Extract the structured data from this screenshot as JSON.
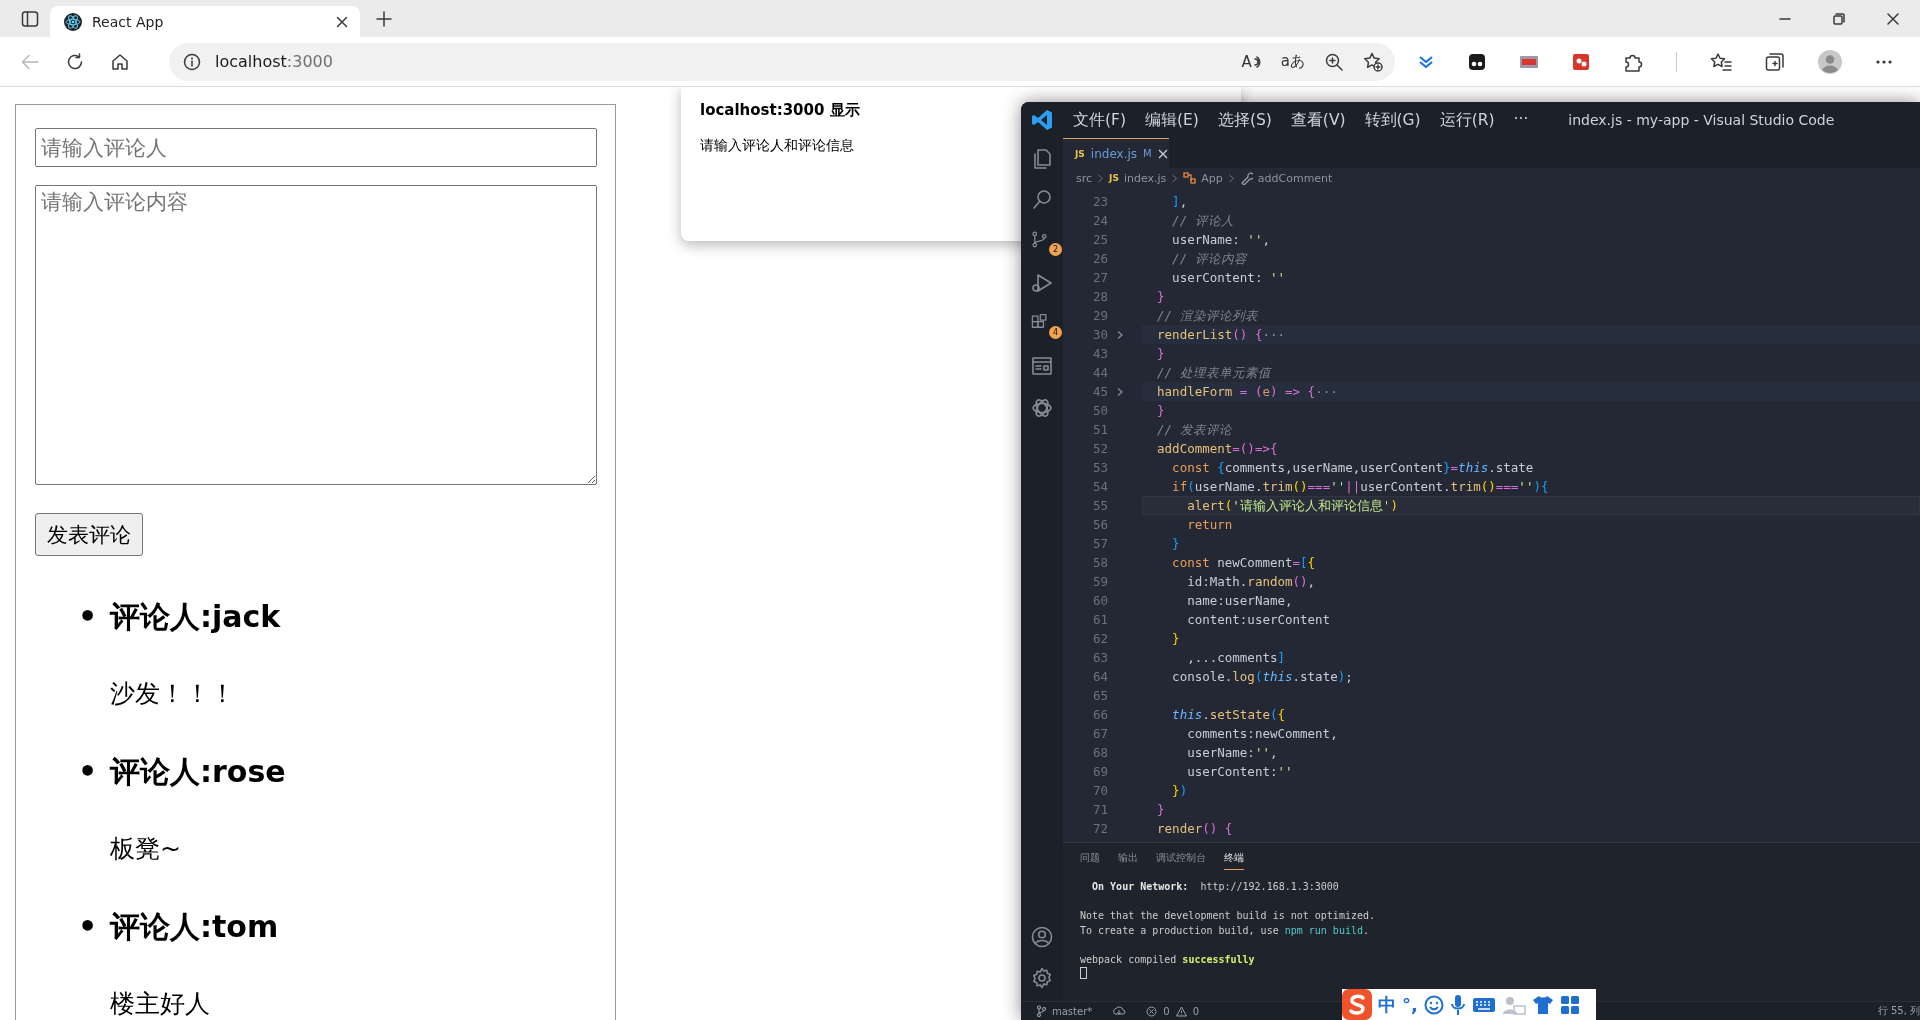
{
  "browser": {
    "tabs": [
      {
        "title": "React App",
        "selected": true
      }
    ],
    "back": {
      "disabled": true
    },
    "address": {
      "host": "localhost",
      "port": ":3000"
    },
    "read_aloud": "A",
    "translate": "aあ"
  },
  "page": {
    "name_placeholder": "请输入评论人",
    "content_placeholder": "请输入评论内容",
    "submit": "发表评论",
    "comments": [
      {
        "bullet": "•",
        "author": "评论人:jack",
        "content": "沙发！！！"
      },
      {
        "bullet": "•",
        "author": "评论人:rose",
        "content": "板凳~"
      },
      {
        "bullet": "•",
        "author": "评论人:tom",
        "content": "楼主好人"
      }
    ]
  },
  "alert": {
    "title": "localhost:3000 显示",
    "message": "请输入评论人和评论信息"
  },
  "vscode": {
    "menu": [
      "文件(F)",
      "编辑(E)",
      "选择(S)",
      "查看(V)",
      "转到(G)",
      "运行(R)",
      "···"
    ],
    "title": "index.js - my-app - Visual Studio Code",
    "scm_badge": "2",
    "extensions_badge": "4",
    "editor_tab": {
      "icon": "JS",
      "name": "index.js",
      "status": "M"
    },
    "breadcrumb": [
      {
        "kind": "folder",
        "text": "src"
      },
      {
        "kind": "file",
        "icon": "JS",
        "text": "index.js"
      },
      {
        "kind": "class",
        "text": "App"
      },
      {
        "kind": "method",
        "text": "addComment"
      }
    ],
    "lines": [
      {
        "number": "23",
        "folded": false,
        "current": false,
        "tokens": [
          {
            "text": "    ]",
            "kind": "bracket3"
          },
          {
            "text": ",",
            "kind": "plain"
          }
        ]
      },
      {
        "number": "24",
        "folded": false,
        "current": false,
        "tokens": [
          {
            "text": "    // 评论人",
            "kind": "comment"
          }
        ]
      },
      {
        "number": "25",
        "folded": false,
        "current": false,
        "tokens": [
          {
            "text": "    userName: ",
            "kind": "plain"
          },
          {
            "text": "''",
            "kind": "string"
          },
          {
            "text": ",",
            "kind": "plain"
          }
        ]
      },
      {
        "number": "26",
        "folded": false,
        "current": false,
        "tokens": [
          {
            "text": "    // 评论内容",
            "kind": "comment"
          }
        ]
      },
      {
        "number": "27",
        "folded": false,
        "current": false,
        "tokens": [
          {
            "text": "    userContent: ",
            "kind": "plain"
          },
          {
            "text": "''",
            "kind": "string"
          }
        ]
      },
      {
        "number": "28",
        "folded": false,
        "current": false,
        "tokens": [
          {
            "text": "  }",
            "kind": "bracket2"
          }
        ]
      },
      {
        "number": "29",
        "folded": false,
        "current": false,
        "tokens": [
          {
            "text": "  // 渲染评论列表",
            "kind": "comment"
          }
        ]
      },
      {
        "number": "30",
        "folded": true,
        "current": false,
        "tokens": [
          {
            "text": "  renderList",
            "kind": "function"
          },
          {
            "text": "() {",
            "kind": "bracket2"
          },
          {
            "text": "···",
            "kind": "ellipsis"
          }
        ]
      },
      {
        "number": "43",
        "folded": false,
        "current": false,
        "tokens": [
          {
            "text": "  }",
            "kind": "bracket2"
          }
        ]
      },
      {
        "number": "44",
        "folded": false,
        "current": false,
        "tokens": [
          {
            "text": "  // 处理表单元素值",
            "kind": "comment"
          }
        ]
      },
      {
        "number": "45",
        "folded": true,
        "current": false,
        "tokens": [
          {
            "text": "  handleForm",
            "kind": "function"
          },
          {
            "text": " = ",
            "kind": "operator"
          },
          {
            "text": "(",
            "kind": "bracket2"
          },
          {
            "text": "e",
            "kind": "parameter"
          },
          {
            "text": ")",
            "kind": "bracket2"
          },
          {
            "text": " => ",
            "kind": "operator"
          },
          {
            "text": "{",
            "kind": "bracket2"
          },
          {
            "text": "···",
            "kind": "ellipsis"
          }
        ]
      },
      {
        "number": "50",
        "folded": false,
        "current": false,
        "tokens": [
          {
            "text": "  }",
            "kind": "bracket2"
          }
        ]
      },
      {
        "number": "51",
        "folded": false,
        "current": false,
        "tokens": [
          {
            "text": "  // 发表评论",
            "kind": "comment"
          }
        ]
      },
      {
        "number": "52",
        "folded": false,
        "current": false,
        "tokens": [
          {
            "text": "  addComment",
            "kind": "function"
          },
          {
            "text": "=",
            "kind": "operator"
          },
          {
            "text": "()",
            "kind": "bracket2"
          },
          {
            "text": "=>",
            "kind": "operator"
          },
          {
            "text": "{",
            "kind": "bracket2"
          }
        ]
      },
      {
        "number": "53",
        "folded": false,
        "current": false,
        "tokens": [
          {
            "text": "    const ",
            "kind": "keyword"
          },
          {
            "text": "{",
            "kind": "bracket3"
          },
          {
            "text": "comments,userName,userContent",
            "kind": "plain"
          },
          {
            "text": "}",
            "kind": "bracket3"
          },
          {
            "text": "=",
            "kind": "operator"
          },
          {
            "text": "this",
            "kind": "self"
          },
          {
            "text": ".state",
            "kind": "plain"
          }
        ]
      },
      {
        "number": "54",
        "folded": false,
        "current": false,
        "tokens": [
          {
            "text": "    if",
            "kind": "keyword"
          },
          {
            "text": "(",
            "kind": "bracket3"
          },
          {
            "text": "userName.",
            "kind": "plain"
          },
          {
            "text": "trim",
            "kind": "function"
          },
          {
            "text": "()",
            "kind": "bracket1"
          },
          {
            "text": "===",
            "kind": "operator"
          },
          {
            "text": "''",
            "kind": "string"
          },
          {
            "text": "||",
            "kind": "operator"
          },
          {
            "text": "userContent.",
            "kind": "plain"
          },
          {
            "text": "trim",
            "kind": "function"
          },
          {
            "text": "()",
            "kind": "bracket1"
          },
          {
            "text": "===",
            "kind": "operator"
          },
          {
            "text": "''",
            "kind": "string"
          },
          {
            "text": "){",
            "kind": "bracket3"
          }
        ]
      },
      {
        "number": "55",
        "folded": false,
        "current": true,
        "tokens": [
          {
            "text": "      alert",
            "kind": "function"
          },
          {
            "text": "(",
            "kind": "bracket1"
          },
          {
            "text": "'请输入评论人和评论信息'",
            "kind": "string"
          },
          {
            "text": ")",
            "kind": "bracket1"
          }
        ]
      },
      {
        "number": "56",
        "folded": false,
        "current": false,
        "tokens": [
          {
            "text": "      return",
            "kind": "keyword"
          }
        ]
      },
      {
        "number": "57",
        "folded": false,
        "current": false,
        "tokens": [
          {
            "text": "    }",
            "kind": "bracket3"
          }
        ]
      },
      {
        "number": "58",
        "folded": false,
        "current": false,
        "tokens": [
          {
            "text": "    const ",
            "kind": "keyword"
          },
          {
            "text": "newComment",
            "kind": "plain"
          },
          {
            "text": "=",
            "kind": "operator"
          },
          {
            "text": "[",
            "kind": "bracket3"
          },
          {
            "text": "{",
            "kind": "bracket1"
          }
        ]
      },
      {
        "number": "59",
        "folded": false,
        "current": false,
        "tokens": [
          {
            "text": "      id:Math.",
            "kind": "plain"
          },
          {
            "text": "random",
            "kind": "function"
          },
          {
            "text": "()",
            "kind": "bracket2"
          },
          {
            "text": ",",
            "kind": "plain"
          }
        ]
      },
      {
        "number": "60",
        "folded": false,
        "current": false,
        "tokens": [
          {
            "text": "      name:userName,",
            "kind": "plain"
          }
        ]
      },
      {
        "number": "61",
        "folded": false,
        "current": false,
        "tokens": [
          {
            "text": "      content:userContent",
            "kind": "plain"
          }
        ]
      },
      {
        "number": "62",
        "folded": false,
        "current": false,
        "tokens": [
          {
            "text": "    }",
            "kind": "bracket1"
          }
        ]
      },
      {
        "number": "63",
        "folded": false,
        "current": false,
        "tokens": [
          {
            "text": "      ,...comments",
            "kind": "plain"
          },
          {
            "text": "]",
            "kind": "bracket3"
          }
        ]
      },
      {
        "number": "64",
        "folded": false,
        "current": false,
        "tokens": [
          {
            "text": "    console.",
            "kind": "plain"
          },
          {
            "text": "log",
            "kind": "function"
          },
          {
            "text": "(",
            "kind": "bracket3"
          },
          {
            "text": "this",
            "kind": "self"
          },
          {
            "text": ".state",
            "kind": "plain"
          },
          {
            "text": ")",
            "kind": "bracket3"
          },
          {
            "text": ";",
            "kind": "plain"
          }
        ]
      },
      {
        "number": "65",
        "folded": false,
        "current": false
      },
      {
        "number": "66",
        "folded": false,
        "current": false,
        "tokens": [
          {
            "text": "    this",
            "kind": "self"
          },
          {
            "text": ".",
            "kind": "plain"
          },
          {
            "text": "setState",
            "kind": "function"
          },
          {
            "text": "(",
            "kind": "bracket3"
          },
          {
            "text": "{",
            "kind": "bracket1"
          }
        ]
      },
      {
        "number": "67",
        "folded": false,
        "current": false,
        "tokens": [
          {
            "text": "      comments:newComment,",
            "kind": "plain"
          }
        ]
      },
      {
        "number": "68",
        "folded": false,
        "current": false,
        "tokens": [
          {
            "text": "      userName:",
            "kind": "plain"
          },
          {
            "text": "''",
            "kind": "string"
          },
          {
            "text": ",",
            "kind": "plain"
          }
        ]
      },
      {
        "number": "69",
        "folded": false,
        "current": false,
        "tokens": [
          {
            "text": "      userContent:",
            "kind": "plain"
          },
          {
            "text": "''",
            "kind": "string"
          }
        ]
      },
      {
        "number": "70",
        "folded": false,
        "current": false,
        "tokens": [
          {
            "text": "    }",
            "kind": "bracket1"
          },
          {
            "text": ")",
            "kind": "bracket3"
          }
        ]
      },
      {
        "number": "71",
        "folded": false,
        "current": false,
        "tokens": [
          {
            "text": "  }",
            "kind": "bracket2"
          }
        ]
      },
      {
        "number": "72",
        "folded": false,
        "current": false,
        "tokens": [
          {
            "text": "  render",
            "kind": "function"
          },
          {
            "text": "() {",
            "kind": "bracket2"
          }
        ]
      }
    ],
    "panel_tabs": [
      {
        "label": "问题",
        "selected": false
      },
      {
        "label": "输出",
        "selected": false
      },
      {
        "label": "调试控制台",
        "selected": false
      },
      {
        "label": "终端",
        "selected": true
      }
    ],
    "terminal": [
      {
        "lines": [
          {
            "segments": [
              {
                "text": "  On Your Network:",
                "kind": "bold"
              },
              {
                "text": "  http://192.168.1.3:3000",
                "kind": "plain"
              }
            ]
          }
        ]
      },
      {
        "lines": [
          {
            "segments": [
              {
                "text": "Note that the development build is not optimized.",
                "kind": "plain"
              }
            ]
          },
          {
            "segments": [
              {
                "text": "To create a production build, use ",
                "kind": "plain"
              },
              {
                "text": "npm run build",
                "kind": "command"
              },
              {
                "text": ".",
                "kind": "plain"
              }
            ]
          }
        ]
      },
      {
        "lines": [
          {
            "segments": [
              {
                "text": "webpack compiled ",
                "kind": "plain"
              },
              {
                "text": "successfully",
                "kind": "success"
              }
            ]
          }
        ]
      }
    ],
    "status_bar": {
      "branch": "master*",
      "errors": "0",
      "warnings": "0",
      "position": "行 55, 列"
    }
  },
  "ime": {
    "mode": "中",
    "punctuation": "°,"
  }
}
